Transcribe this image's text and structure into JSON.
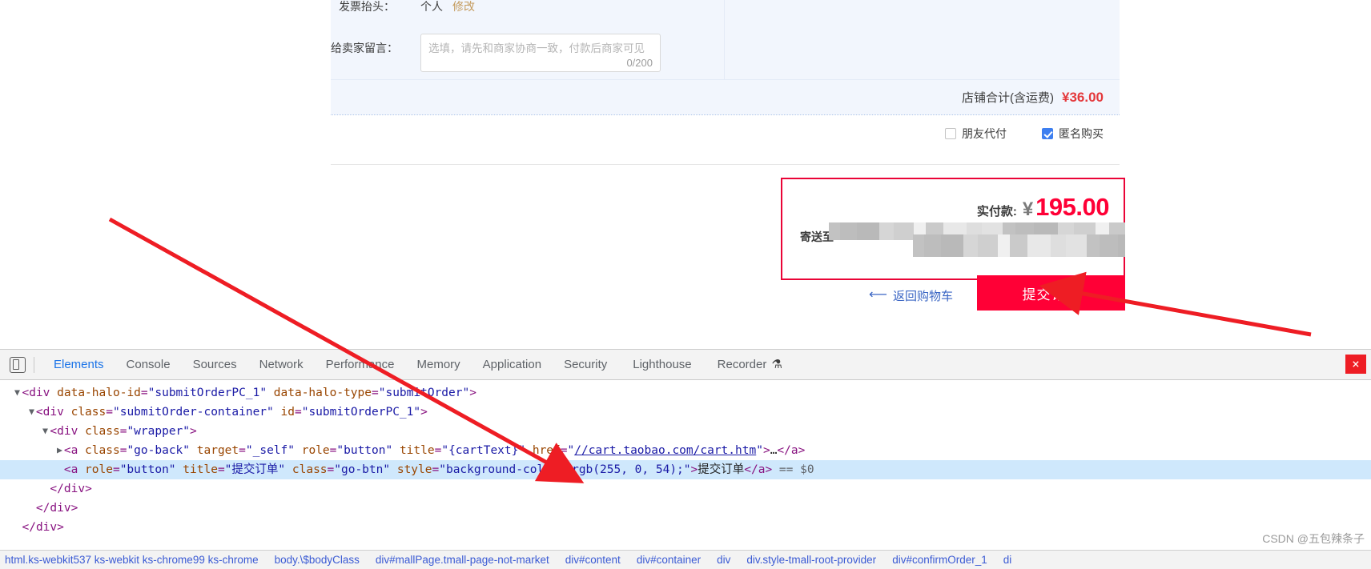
{
  "page": {
    "invoice": {
      "label": "发票抬头：",
      "value": "个人",
      "modify_link": "修改"
    },
    "message": {
      "label": "给卖家留言：",
      "placeholder": "选填，请先和商家协商一致，付款后商家可见",
      "counter": "0/200"
    },
    "shop_total": {
      "label": "店铺合计(含运费)",
      "value": "¥36.00"
    },
    "options": [
      {
        "label": "朋友代付",
        "checked": false
      },
      {
        "label": "匿名购买",
        "checked": true
      }
    ],
    "pay_box": {
      "amount_label": "实付款:",
      "currency": "¥",
      "amount": "195.00",
      "ship_label": "寄送至",
      "ship_value_redacted": true
    },
    "actions": {
      "go_back_label": "返回购物车",
      "go_back_icon": "arrow-left-icon",
      "submit_label": "提交订单",
      "submit_color": "#ff0036"
    }
  },
  "devtools": {
    "device_toggle_icon": "device-toolbar-icon",
    "tabs": [
      {
        "label": "Elements",
        "active": true
      },
      {
        "label": "Console",
        "active": false
      },
      {
        "label": "Sources",
        "active": false
      },
      {
        "label": "Network",
        "active": false
      },
      {
        "label": "Performance",
        "active": false
      },
      {
        "label": "Memory",
        "active": false
      },
      {
        "label": "Application",
        "active": false
      },
      {
        "label": "Security",
        "active": false
      },
      {
        "label": "Lighthouse",
        "active": false
      },
      {
        "label": "Recorder",
        "active": false
      }
    ],
    "recorder_badge_icon": "flask-icon",
    "close_icon": "×",
    "dom_lines": [
      {
        "indent": 1,
        "triangle": "▼",
        "selected": false,
        "parts": [
          {
            "t": "punct",
            "v": "<"
          },
          {
            "t": "tag",
            "v": "div"
          },
          {
            "t": "space",
            "v": " "
          },
          {
            "t": "attr",
            "v": "data-halo-id"
          },
          {
            "t": "punct",
            "v": "="
          },
          {
            "t": "val",
            "v": "\"submitOrderPC_1\""
          },
          {
            "t": "space",
            "v": " "
          },
          {
            "t": "attr",
            "v": "data-halo-type"
          },
          {
            "t": "punct",
            "v": "="
          },
          {
            "t": "val",
            "v": "\"submitOrder\""
          },
          {
            "t": "punct",
            "v": ">"
          }
        ]
      },
      {
        "indent": 2,
        "triangle": "▼",
        "selected": false,
        "parts": [
          {
            "t": "punct",
            "v": "<"
          },
          {
            "t": "tag",
            "v": "div"
          },
          {
            "t": "space",
            "v": " "
          },
          {
            "t": "attr",
            "v": "class"
          },
          {
            "t": "punct",
            "v": "="
          },
          {
            "t": "val",
            "v": "\"submitOrder-container\""
          },
          {
            "t": "space",
            "v": " "
          },
          {
            "t": "attr",
            "v": "id"
          },
          {
            "t": "punct",
            "v": "="
          },
          {
            "t": "val",
            "v": "\"submitOrderPC_1\""
          },
          {
            "t": "punct",
            "v": ">"
          }
        ]
      },
      {
        "indent": 3,
        "triangle": "▼",
        "selected": false,
        "parts": [
          {
            "t": "punct",
            "v": "<"
          },
          {
            "t": "tag",
            "v": "div"
          },
          {
            "t": "space",
            "v": " "
          },
          {
            "t": "attr",
            "v": "class"
          },
          {
            "t": "punct",
            "v": "="
          },
          {
            "t": "val",
            "v": "\"wrapper\""
          },
          {
            "t": "punct",
            "v": ">"
          }
        ]
      },
      {
        "indent": 4,
        "triangle": "▶",
        "selected": false,
        "parts": [
          {
            "t": "punct",
            "v": "<"
          },
          {
            "t": "tag",
            "v": "a"
          },
          {
            "t": "space",
            "v": " "
          },
          {
            "t": "attr",
            "v": "class"
          },
          {
            "t": "punct",
            "v": "="
          },
          {
            "t": "val",
            "v": "\"go-back\""
          },
          {
            "t": "space",
            "v": " "
          },
          {
            "t": "attr",
            "v": "target"
          },
          {
            "t": "punct",
            "v": "="
          },
          {
            "t": "val",
            "v": "\"_self\""
          },
          {
            "t": "space",
            "v": " "
          },
          {
            "t": "attr",
            "v": "role"
          },
          {
            "t": "punct",
            "v": "="
          },
          {
            "t": "val",
            "v": "\"button\""
          },
          {
            "t": "space",
            "v": " "
          },
          {
            "t": "attr",
            "v": "title"
          },
          {
            "t": "punct",
            "v": "="
          },
          {
            "t": "val",
            "v": "\"{cartText}\""
          },
          {
            "t": "space",
            "v": " "
          },
          {
            "t": "attr",
            "v": "href"
          },
          {
            "t": "punct",
            "v": "="
          },
          {
            "t": "val",
            "v": "\""
          },
          {
            "t": "link",
            "v": "//cart.taobao.com/cart.htm"
          },
          {
            "t": "val",
            "v": "\""
          },
          {
            "t": "punct",
            "v": ">"
          },
          {
            "t": "text",
            "v": "…"
          },
          {
            "t": "punct",
            "v": "</"
          },
          {
            "t": "tag",
            "v": "a"
          },
          {
            "t": "punct",
            "v": ">"
          }
        ]
      },
      {
        "indent": 4,
        "triangle": "",
        "selected": true,
        "parts": [
          {
            "t": "punct",
            "v": "<"
          },
          {
            "t": "tag",
            "v": "a"
          },
          {
            "t": "space",
            "v": " "
          },
          {
            "t": "attr",
            "v": "role"
          },
          {
            "t": "punct",
            "v": "="
          },
          {
            "t": "val",
            "v": "\"button\""
          },
          {
            "t": "space",
            "v": " "
          },
          {
            "t": "attr",
            "v": "title"
          },
          {
            "t": "punct",
            "v": "="
          },
          {
            "t": "val",
            "v": "\"提交订单\""
          },
          {
            "t": "space",
            "v": " "
          },
          {
            "t": "attr",
            "v": "class"
          },
          {
            "t": "punct",
            "v": "="
          },
          {
            "t": "val",
            "v": "\"go-btn\""
          },
          {
            "t": "space",
            "v": " "
          },
          {
            "t": "attr",
            "v": "style"
          },
          {
            "t": "punct",
            "v": "="
          },
          {
            "t": "val",
            "v": "\"background-color: rgb(255, 0, 54);\""
          },
          {
            "t": "punct",
            "v": ">"
          },
          {
            "t": "text",
            "v": "提交订单"
          },
          {
            "t": "punct",
            "v": "</"
          },
          {
            "t": "tag",
            "v": "a"
          },
          {
            "t": "punct",
            "v": ">"
          },
          {
            "t": "space",
            "v": " "
          },
          {
            "t": "dollar",
            "v": "== $0"
          }
        ]
      },
      {
        "indent": 3,
        "triangle": "",
        "selected": false,
        "parts": [
          {
            "t": "punct",
            "v": "</"
          },
          {
            "t": "tag",
            "v": "div"
          },
          {
            "t": "punct",
            "v": ">"
          }
        ]
      },
      {
        "indent": 2,
        "triangle": "",
        "selected": false,
        "parts": [
          {
            "t": "punct",
            "v": "</"
          },
          {
            "t": "tag",
            "v": "div"
          },
          {
            "t": "punct",
            "v": ">"
          }
        ]
      },
      {
        "indent": 1,
        "triangle": "",
        "selected": false,
        "parts": [
          {
            "t": "punct",
            "v": "</"
          },
          {
            "t": "tag",
            "v": "div"
          },
          {
            "t": "punct",
            "v": ">"
          }
        ]
      },
      {
        "indent": 0,
        "triangle": "",
        "selected": false,
        "parts": [
          {
            "t": "punct",
            "v": "</"
          },
          {
            "t": "tag",
            "v": "div"
          },
          {
            "t": "punct",
            "v": ">"
          }
        ]
      }
    ],
    "breadcrumb": [
      "html.ks-webkit537 ks-webkit ks-chrome99 ks-chrome",
      "body.\\$bodyClass",
      "div#mallPage.tmall-page-not-market",
      "div#content",
      "div#container",
      "div",
      "div.style-tmall-root-provider",
      "div#confirmOrder_1",
      "di"
    ]
  },
  "watermark": "CSDN @五包辣条子"
}
